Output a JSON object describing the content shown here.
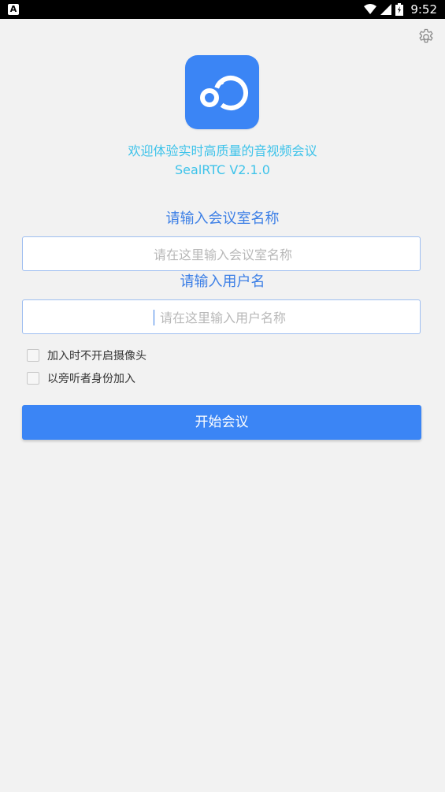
{
  "status_bar": {
    "left_icon_letter": "A",
    "battery_text": "",
    "time": "9:52"
  },
  "header": {
    "welcome": "欢迎体验实时高质量的音视频会议",
    "version": "SealRTC V2.1.0"
  },
  "form": {
    "room_label": "请输入会议室名称",
    "room_value": "",
    "room_placeholder": "请在这里输入会议室名称",
    "user_label": "请输入用户名",
    "user_value": "",
    "user_placeholder": "请在这里输入用户名称"
  },
  "options": [
    {
      "label": "加入时不开启摄像头",
      "checked": false
    },
    {
      "label": "以旁听者身份加入",
      "checked": false
    }
  ],
  "actions": {
    "start_label": "开始会议"
  },
  "colors": {
    "brand": "#3b85f5",
    "welcome_text": "#3ec3ea",
    "label_text": "#3c7fe6",
    "background": "#f2f2f2"
  },
  "icons": {
    "settings": "gear-icon",
    "logo": "sealrtc-logo-icon"
  }
}
